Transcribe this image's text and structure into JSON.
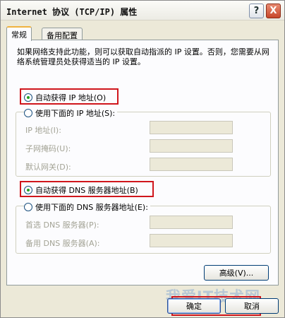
{
  "window": {
    "title": "Internet 协议 (TCP/IP) 属性",
    "help_btn": "?",
    "close_btn": "X"
  },
  "tabs": [
    {
      "label": "常规",
      "active": true
    },
    {
      "label": "备用配置",
      "active": false
    }
  ],
  "description": "如果网络支持此功能，则可以获取自动指派的 IP 设置。否则，您需要从网络系统管理员处获得适当的 IP 设置。",
  "ip": {
    "auto_label": "自动获得 IP 地址(O)",
    "auto_checked": true,
    "manual_label": "使用下面的 IP 地址(S):",
    "manual_checked": false,
    "fields": [
      {
        "label": "IP 地址(I):",
        "value": ""
      },
      {
        "label": "子网掩码(U):",
        "value": ""
      },
      {
        "label": "默认网关(D):",
        "value": ""
      }
    ]
  },
  "dns": {
    "auto_label": "自动获得 DNS 服务器地址(B)",
    "auto_checked": true,
    "manual_label": "使用下面的 DNS 服务器地址(E):",
    "manual_checked": false,
    "fields": [
      {
        "label": "首选 DNS 服务器(P):",
        "value": ""
      },
      {
        "label": "备用 DNS 服务器(A):",
        "value": ""
      }
    ]
  },
  "buttons": {
    "advanced": "高级(V)...",
    "ok": "确定",
    "cancel": "取消"
  },
  "watermark": "我爱IT技术网",
  "colors": {
    "highlight": "#d0161c",
    "radio_dot": "#21a121"
  }
}
